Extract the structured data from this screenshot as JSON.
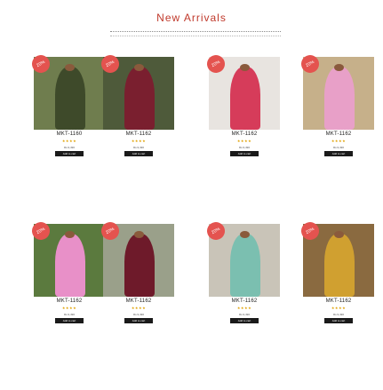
{
  "section": {
    "title": "New Arrivals",
    "subtitle": ""
  },
  "products": [
    {
      "badge": "20%",
      "sku": "MKT-1160",
      "price": "Rs.9,490",
      "cart_label": "Add to cart",
      "rating": 4,
      "colors": {
        "bg": "#6f7d4e",
        "dress": "#3e4a2a"
      }
    },
    {
      "badge": "20%",
      "sku": "MKT-1162",
      "price": "Rs.9,490",
      "cart_label": "Add to cart",
      "rating": 4,
      "colors": {
        "bg": "#4e5a3a",
        "dress": "#7a1f2f"
      }
    },
    {
      "badge": "20%",
      "sku": "MKT-1162",
      "price": "Rs.9,490",
      "cart_label": "Add to cart",
      "rating": 4,
      "colors": {
        "bg": "#e8e4e0",
        "dress": "#d63c5a"
      }
    },
    {
      "badge": "20%",
      "sku": "MKT-1162",
      "price": "Rs.9,490",
      "cart_label": "Add to cart",
      "rating": 4,
      "colors": {
        "bg": "#c6b08a",
        "dress": "#e8a0c8"
      }
    },
    {
      "badge": "20%",
      "sku": "MKT-1162",
      "price": "Rs.9,490",
      "cart_label": "Add to cart",
      "rating": 4,
      "colors": {
        "bg": "#5b7a3e",
        "dress": "#e890c8"
      }
    },
    {
      "badge": "20%",
      "sku": "MKT-1162",
      "price": "Rs.9,490",
      "cart_label": "Add to cart",
      "rating": 4,
      "colors": {
        "bg": "#9aa08a",
        "dress": "#6e1a2a"
      }
    },
    {
      "badge": "20%",
      "sku": "MKT-1162",
      "price": "Rs.9,490",
      "cart_label": "Add to cart",
      "rating": 4,
      "colors": {
        "bg": "#c9c4b8",
        "dress": "#7bbfb0"
      }
    },
    {
      "badge": "20%",
      "sku": "MKT-1162",
      "price": "Rs.9,490",
      "cart_label": "Add to cart",
      "rating": 4,
      "colors": {
        "bg": "#8a6a40",
        "dress": "#d0a030"
      }
    }
  ]
}
